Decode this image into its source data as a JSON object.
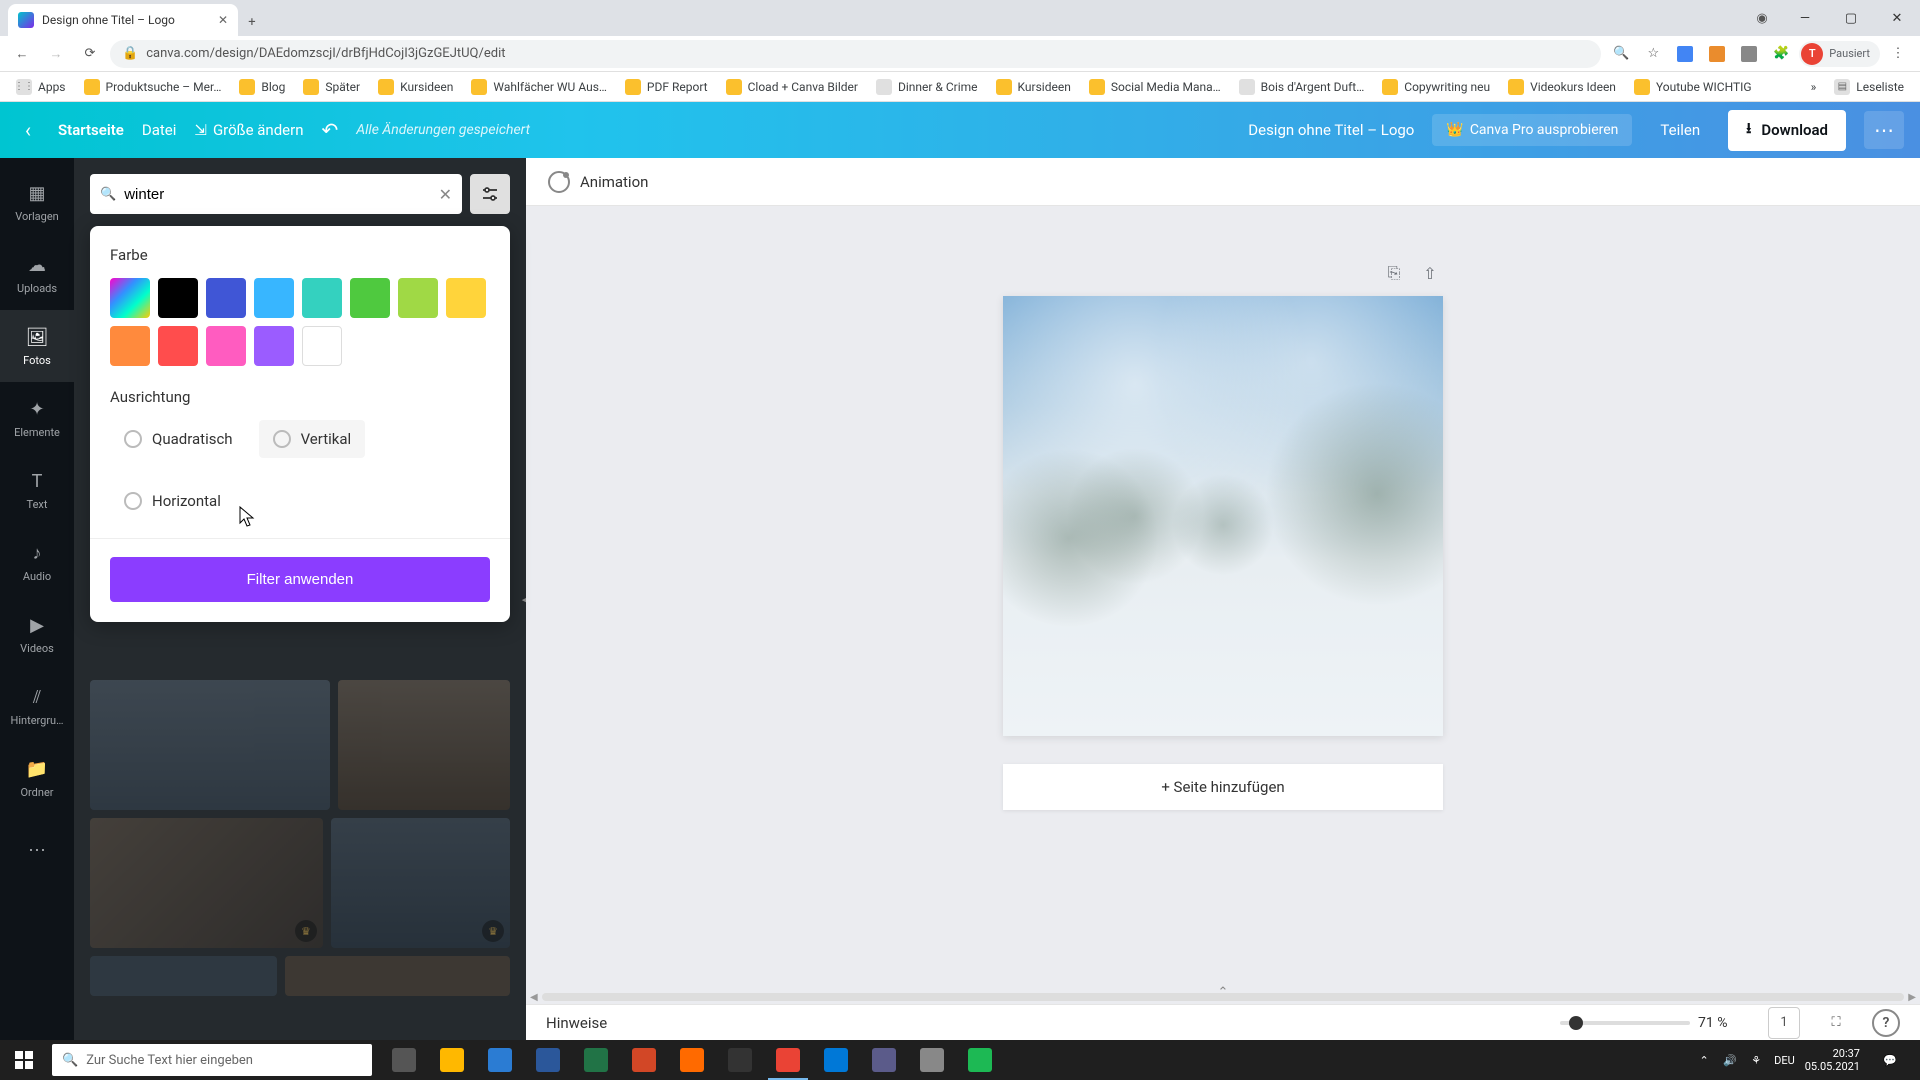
{
  "browser": {
    "tab_title": "Design ohne Titel – Logo",
    "url": "canva.com/design/DAEdomzscjI/drBfjHdCojI3jGzGEJtUQ/edit",
    "profile_letter": "T",
    "profile_status": "Pausiert"
  },
  "bookmarks": [
    {
      "label": "Apps",
      "kind": "apps"
    },
    {
      "label": "Produktsuche – Mer…",
      "kind": "folder"
    },
    {
      "label": "Blog",
      "kind": "folder"
    },
    {
      "label": "Später",
      "kind": "folder"
    },
    {
      "label": "Kursideen",
      "kind": "folder"
    },
    {
      "label": "Wahlfächer WU Aus…",
      "kind": "folder"
    },
    {
      "label": "PDF Report",
      "kind": "folder"
    },
    {
      "label": "Cload + Canva Bilder",
      "kind": "folder"
    },
    {
      "label": "Dinner & Crime",
      "kind": "page"
    },
    {
      "label": "Kursideen",
      "kind": "folder"
    },
    {
      "label": "Social Media Mana…",
      "kind": "folder"
    },
    {
      "label": "Bois d'Argent Duft…",
      "kind": "page"
    },
    {
      "label": "Copywriting neu",
      "kind": "folder"
    },
    {
      "label": "Videokurs Ideen",
      "kind": "folder"
    },
    {
      "label": "Youtube WICHTIG",
      "kind": "folder"
    },
    {
      "label": "Leseliste",
      "kind": "reading"
    }
  ],
  "topbar": {
    "home": "Startseite",
    "file": "Datei",
    "resize": "Größe ändern",
    "saved": "Alle Änderungen gespeichert",
    "doc_title": "Design ohne Titel – Logo",
    "pro": "Canva Pro ausprobieren",
    "share": "Teilen",
    "download": "Download"
  },
  "rail": [
    {
      "label": "Vorlagen"
    },
    {
      "label": "Uploads"
    },
    {
      "label": "Fotos"
    },
    {
      "label": "Elemente"
    },
    {
      "label": "Text"
    },
    {
      "label": "Audio"
    },
    {
      "label": "Videos"
    },
    {
      "label": "Hintergru…"
    },
    {
      "label": "Ordner"
    }
  ],
  "rail_active_index": 2,
  "search": {
    "value": "winter"
  },
  "filter": {
    "color_title": "Farbe",
    "orientation_title": "Ausrichtung",
    "orientations": [
      {
        "label": "Quadratisch"
      },
      {
        "label": "Vertikal"
      },
      {
        "label": "Horizontal"
      }
    ],
    "apply": "Filter anwenden",
    "colors": [
      "rainbow",
      "#000000",
      "#4056d6",
      "#38b6ff",
      "#34d1bf",
      "#4fc93f",
      "#a0d945",
      "#ffd43b",
      "#ff8a3d",
      "#ff4d4d",
      "#ff5cc0",
      "#9b5cff",
      "#ffffff"
    ]
  },
  "canvas_toolbar": {
    "animation": "Animation"
  },
  "canvas": {
    "add_page": "+ Seite hinzufügen"
  },
  "status": {
    "notes": "Hinweise",
    "zoom": "71 %",
    "zoom_pct_value": 71,
    "page_num": "1"
  },
  "taskbar": {
    "search_placeholder": "Zur Suche Text hier eingeben",
    "lang": "DEU",
    "time": "20:37",
    "date": "05.05.2021"
  }
}
